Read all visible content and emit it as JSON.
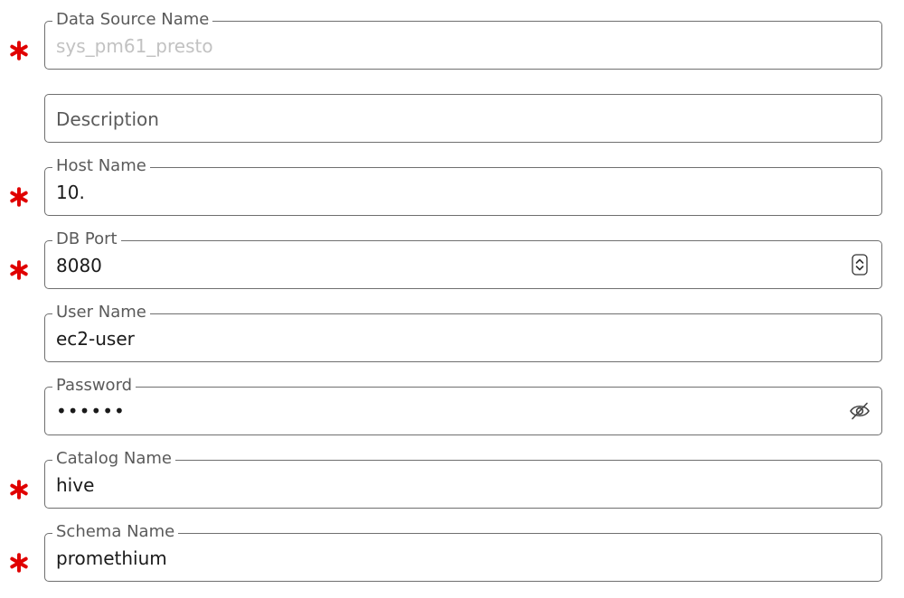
{
  "form": {
    "data_source_name": {
      "label": "Data Source Name",
      "value": "sys_pm61_presto"
    },
    "description": {
      "placeholder": "Description"
    },
    "host_name": {
      "label": "Host Name",
      "value": "10."
    },
    "db_port": {
      "label": "DB Port",
      "value": "8080"
    },
    "user_name": {
      "label": "User Name",
      "value": "ec2-user"
    },
    "password": {
      "label": "Password",
      "value": "••••••"
    },
    "catalog_name": {
      "label": "Catalog Name",
      "value": "hive"
    },
    "schema_name": {
      "label": "Schema Name",
      "value": "promethium"
    }
  },
  "icons": {
    "required": "asterisk-icon",
    "stepper": "stepper-icon",
    "toggle_password": "eye-off-icon"
  },
  "colors": {
    "required_mark": "#e00000",
    "border": "#6f6f6f",
    "label_text": "#5a5a5a",
    "disabled_text": "#c2c2c2"
  }
}
